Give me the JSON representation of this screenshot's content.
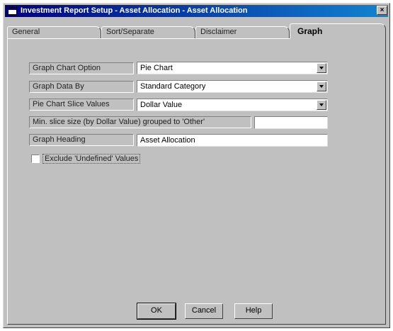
{
  "window": {
    "title": "Investment Report Setup - Asset Allocation - Asset Allocation",
    "close_glyph": "×"
  },
  "tabs": [
    {
      "label": "General",
      "active": false
    },
    {
      "label": "Sort/Separate",
      "active": false
    },
    {
      "label": "Disclaimer",
      "active": false
    },
    {
      "label": "Graph",
      "active": true
    }
  ],
  "form": {
    "graph_chart_option": {
      "label": "Graph Chart Option",
      "value": "Pie Chart"
    },
    "graph_data_by": {
      "label": "Graph Data By",
      "value": "Standard Category"
    },
    "pie_slice_values": {
      "label": "Pie Chart Slice Values",
      "value": "Dollar Value"
    },
    "min_slice": {
      "label": "Min. slice size (by Dollar Value) grouped to 'Other'",
      "value": ""
    },
    "graph_heading": {
      "label": "Graph Heading",
      "value": "Asset Allocation"
    },
    "exclude_undefined": {
      "label": "Exclude 'Undefined' Values",
      "checked": false
    }
  },
  "buttons": {
    "ok": "OK",
    "cancel": "Cancel",
    "help": "Help"
  }
}
